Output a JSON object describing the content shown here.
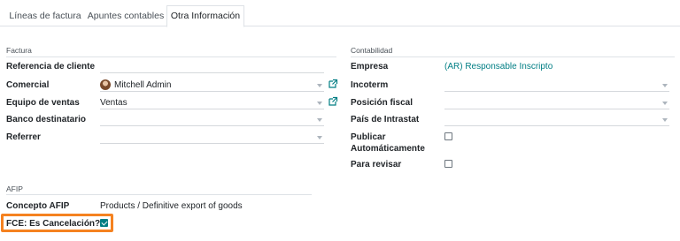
{
  "tabs": [
    {
      "label": "Líneas de factura"
    },
    {
      "label": "Apuntes contables"
    },
    {
      "label": "Otra Información"
    }
  ],
  "factura": {
    "title": "Factura",
    "referencia_label": "Referencia de cliente",
    "referencia_value": "",
    "comercial_label": "Comercial",
    "comercial_value": "Mitchell Admin",
    "equipo_label": "Equipo de ventas",
    "equipo_value": "Ventas",
    "banco_label": "Banco destinatario",
    "banco_value": "",
    "referrer_label": "Referrer",
    "referrer_value": ""
  },
  "contabilidad": {
    "title": "Contabilidad",
    "empresa_label": "Empresa",
    "empresa_value": "(AR) Responsable Inscripto",
    "incoterm_label": "Incoterm",
    "posicion_label": "Posición fiscal",
    "pais_label": "País de Intrastat",
    "publicar_label_1": "Publicar",
    "publicar_label_2": "Automáticamente",
    "publicar_checked": false,
    "revisar_label": "Para revisar",
    "revisar_checked": false
  },
  "afip": {
    "title": "AFIP",
    "concepto_label": "Concepto AFIP",
    "concepto_value": "Products / Definitive export of goods",
    "fce_label": "FCE: Es Cancelación?",
    "fce_checked": true
  },
  "colors": {
    "accent": "#017e84",
    "highlight": "#f58220"
  }
}
